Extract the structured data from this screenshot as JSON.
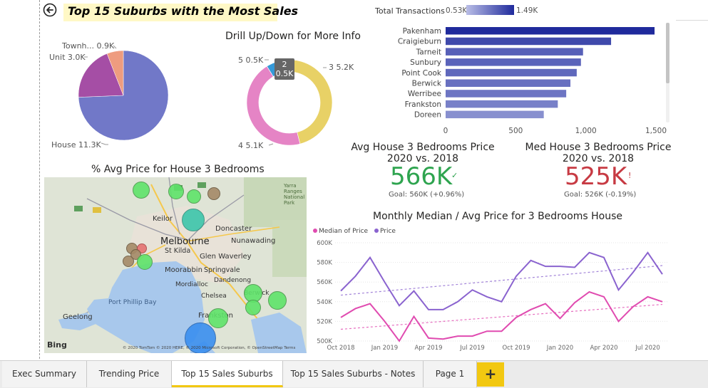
{
  "header": {
    "title": "Top 15 Suburbs with the Most Sales"
  },
  "pie": {
    "slices": [
      {
        "label": "House 11.3K",
        "value": 11.3,
        "color": "#7178c8"
      },
      {
        "label": "Unit 3.0K",
        "value": 3.0,
        "color": "#a54ea5"
      },
      {
        "label": "Townh... 0.9K",
        "value": 0.9,
        "color": "#ee9c7f"
      }
    ]
  },
  "donut": {
    "title": "Drill Up/Down for More Info",
    "slices": [
      {
        "label": "3 5.2K",
        "value": 5.2,
        "color": "#e8d166"
      },
      {
        "label": "4 5.1K",
        "value": 5.1,
        "color": "#e584c5"
      },
      {
        "label": "5 0.5K",
        "value": 0.5,
        "color": "#3599d8"
      },
      {
        "label": "2 0.5K",
        "value": 0.5,
        "color": "#2e8b57"
      }
    ],
    "tooltip_line1": "2",
    "tooltip_line2": "0.5K"
  },
  "bar_legend": {
    "title": "Total Transactions",
    "min": "0.53K",
    "max": "1.49K"
  },
  "chart_data": [
    {
      "type": "pie",
      "categories": [
        "House",
        "Unit",
        "Townh..."
      ],
      "values": [
        11.3,
        3.0,
        0.9
      ],
      "unit": "K"
    },
    {
      "type": "pie",
      "title": "Drill Up/Down for More Info",
      "categories": [
        "3",
        "4",
        "5",
        "2"
      ],
      "values": [
        5.2,
        5.1,
        0.5,
        0.5
      ],
      "unit": "K"
    },
    {
      "type": "bar",
      "orientation": "horizontal",
      "categories": [
        "Pakenham",
        "Craigieburn",
        "Tarneit",
        "Sunbury",
        "Point Cook",
        "Berwick",
        "Werribee",
        "Frankston",
        "Doreen"
      ],
      "values": [
        1490,
        1180,
        980,
        965,
        935,
        890,
        860,
        800,
        700
      ],
      "xlim": [
        0,
        1500
      ],
      "xticks": [
        "0",
        "500",
        "1,000",
        "1,500"
      ],
      "legend_title": "Total Transactions",
      "legend_min": "0.53K",
      "legend_max": "1.49K"
    },
    {
      "type": "line",
      "title": "Monthly Median / Avg Price for 3 Bedrooms House",
      "x": [
        "2018-10",
        "2018-11",
        "2018-12",
        "2019-01",
        "2019-02",
        "2019-03",
        "2019-04",
        "2019-05",
        "2019-06",
        "2019-07",
        "2019-08",
        "2019-09",
        "2019-10",
        "2019-11",
        "2019-12",
        "2020-01",
        "2020-02",
        "2020-03",
        "2020-04",
        "2020-05",
        "2020-06",
        "2020-07"
      ],
      "xticks": [
        "Oct 2018",
        "Jan 2019",
        "Apr 2019",
        "Jul 2019",
        "Oct 2019",
        "Jan 2020",
        "Apr 2020",
        "Jul 2020"
      ],
      "ylim": [
        500,
        600
      ],
      "yticks": [
        "500K",
        "520K",
        "540K",
        "560K",
        "580K",
        "600K"
      ],
      "series": [
        {
          "name": "Median of Price",
          "color": "#e04bb0",
          "values": [
            524,
            533,
            538,
            520,
            500,
            525,
            503,
            502,
            505,
            505,
            510,
            510,
            524,
            532,
            538,
            523,
            539,
            550,
            545,
            520,
            535,
            545,
            540
          ]
        },
        {
          "name": "Price",
          "color": "#8a63cf",
          "values": [
            551,
            566,
            585,
            560,
            536,
            551,
            532,
            532,
            540,
            552,
            545,
            540,
            566,
            582,
            576,
            576,
            575,
            590,
            585,
            552,
            570,
            590,
            568
          ]
        }
      ],
      "legend": "top-left"
    }
  ],
  "bars": {
    "items": [
      {
        "label": "Pakenham",
        "value": 1490,
        "color": "#1f2a9c"
      },
      {
        "label": "Craigieburn",
        "value": 1180,
        "color": "#3f49ab"
      },
      {
        "label": "Tarneit",
        "value": 980,
        "color": "#5760b8"
      },
      {
        "label": "Sunbury",
        "value": 965,
        "color": "#5a63ba"
      },
      {
        "label": "Point Cook",
        "value": 935,
        "color": "#5f68bc"
      },
      {
        "label": "Berwick",
        "value": 890,
        "color": "#6870c0"
      },
      {
        "label": "Werribee",
        "value": 860,
        "color": "#6d75c3"
      },
      {
        "label": "Frankston",
        "value": 800,
        "color": "#7880c8"
      },
      {
        "label": "Doreen",
        "value": 700,
        "color": "#8890cf"
      }
    ],
    "xticks": [
      "0",
      "500",
      "1,000",
      "1,500"
    ]
  },
  "kpi_left": {
    "title_line1": "Avg House 3 Bedrooms Price",
    "title_line2": "2020 vs. 2018",
    "value": "566K",
    "mark": "✓",
    "goal": "Goal: 560K (+0.96%)",
    "color": "#2ea44f"
  },
  "kpi_right": {
    "title_line1": "Med House 3 Bedrooms Price",
    "title_line2": "2020 vs. 2018",
    "value": "525K",
    "mark": "!",
    "goal": "Goal: 526K (-0.19%)",
    "color": "#c73a43"
  },
  "map": {
    "title": "% Avg Price for House 3 Bedrooms",
    "labels": {
      "melbourne": "Melbourne",
      "keilor": "Keilor",
      "doncaster": "Doncaster",
      "nunawading": "Nunawading",
      "stkilda": "St Kilda",
      "glenwaverley": "Glen Waverley",
      "moorabbin": "Moorabbin",
      "springvale": "Springvale",
      "dandenong": "Dandenong",
      "mordialloc": "Mordialloc",
      "chelsea": "Chelsea",
      "berwick": "Berwick",
      "frankston": "Frankston",
      "portphillip": "Port Phillip Bay",
      "geelong": "Geelong",
      "yarra": "Yarra Ranges National Park"
    },
    "attribution": "© 2020 TomTom © 2020 HERE, © 2020 Microsoft Corporation, © OpenStreetMap Terms",
    "logo": "Bing"
  },
  "line_chart": {
    "title": "Monthly Median / Avg Price for 3 Bedrooms House",
    "legend_median": "Median of Price",
    "legend_price": "Price"
  },
  "tabs": [
    {
      "label": "Exec Summary"
    },
    {
      "label": "Trending Price"
    },
    {
      "label": "Top 15 Sales Suburbs"
    },
    {
      "label": "Top 15 Sales Suburbs - Notes"
    },
    {
      "label": "Page 1"
    }
  ],
  "tab_add": "+"
}
